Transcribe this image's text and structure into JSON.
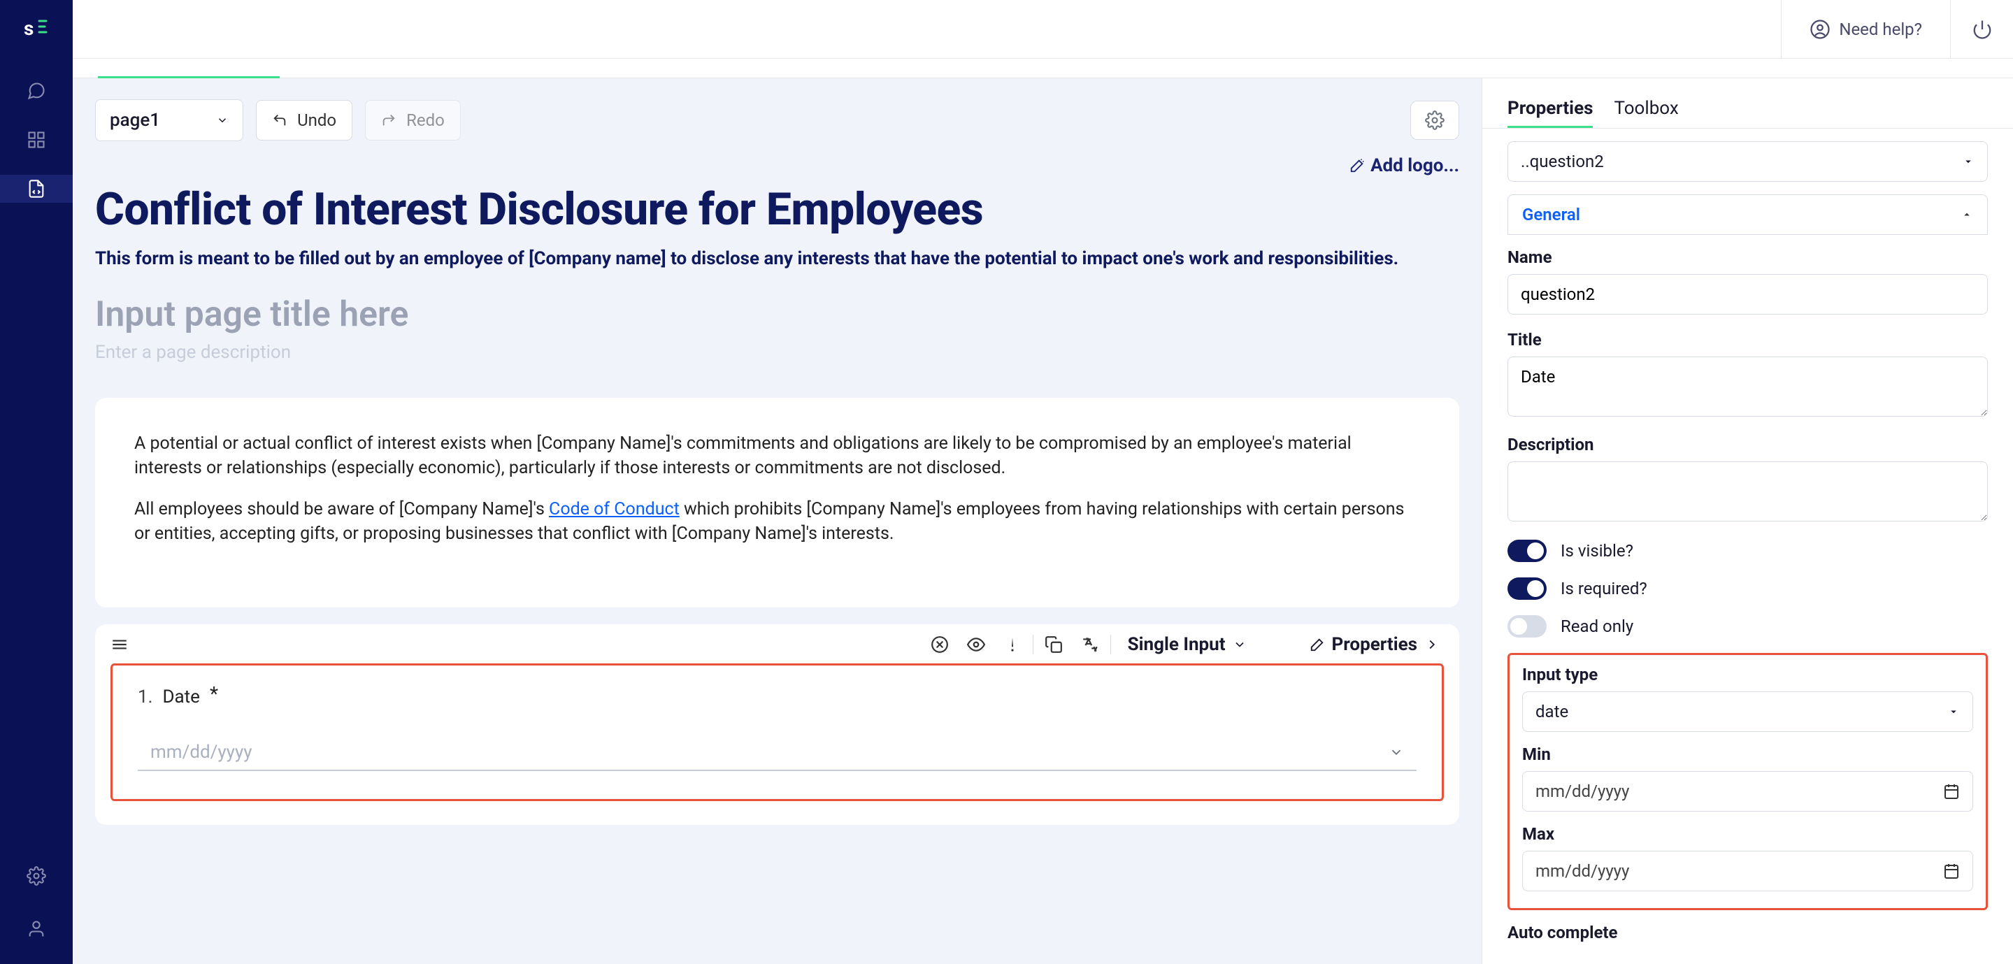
{
  "header": {
    "help_label": "Need help?"
  },
  "canvas_toolbar": {
    "page_select": "page1",
    "undo": "Undo",
    "redo": "Redo"
  },
  "form": {
    "add_logo": "Add logo...",
    "title": "Conflict of Interest Disclosure for Employees",
    "subtitle": "This form is meant to be filled out by an employee of [Company name] to disclose any interests that have the potential to impact one's work and responsibilities.",
    "page_title_placeholder": "Input page title here",
    "page_desc_placeholder": "Enter a page description",
    "info_p1": "A potential or actual conflict of interest exists when [Company Name]'s commitments and obligations are likely to be compromised by an employee's material interests or relationships (especially economic), particularly if those interests or commitments are not disclosed.",
    "info_p2a": "All employees should be aware of [Company Name]'s ",
    "info_p2_link": "Code of Conduct",
    "info_p2b": " which prohibits [Company Name]'s employees from having relationships with certain persons or entities, accepting gifts, or proposing businesses that conflict with [Company Name]'s interests."
  },
  "question_toolbar": {
    "type": "Single Input",
    "properties": "Properties"
  },
  "question": {
    "num": "1.",
    "label": "Date",
    "required_mark": "*",
    "date_placeholder": "mm/dd/yyyy"
  },
  "panel": {
    "tabs": {
      "properties": "Properties",
      "toolbox": "Toolbox"
    },
    "selector": "..question2",
    "accordion_general": "General",
    "labels": {
      "name": "Name",
      "title": "Title",
      "description": "Description",
      "is_visible": "Is visible?",
      "is_required": "Is required?",
      "read_only": "Read only",
      "input_type": "Input type",
      "min": "Min",
      "max": "Max",
      "auto_complete": "Auto complete"
    },
    "values": {
      "name": "question2",
      "title": "Date",
      "description": "",
      "is_visible": true,
      "is_required": true,
      "read_only": false,
      "input_type": "date",
      "min_placeholder": "mm/dd/yyyy",
      "max_placeholder": "mm/dd/yyyy"
    }
  }
}
